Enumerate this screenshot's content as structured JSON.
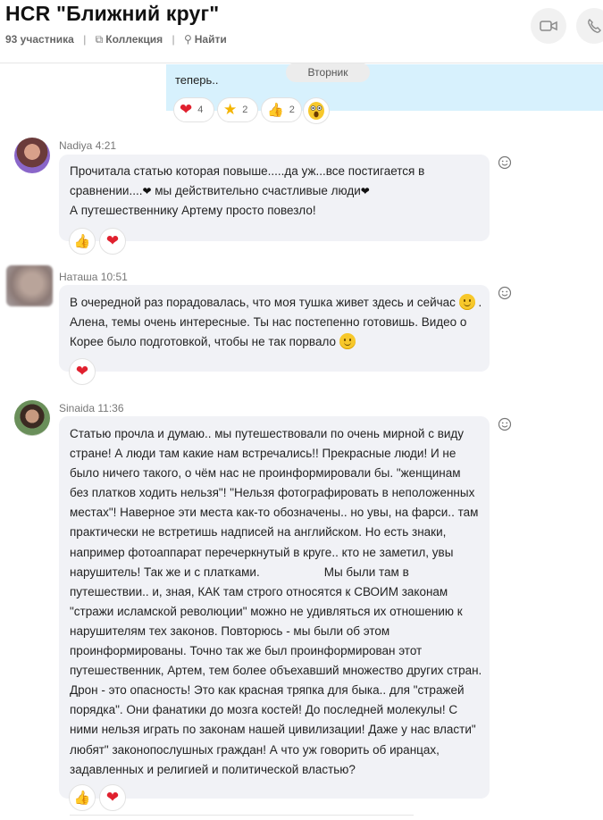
{
  "header": {
    "title": "HCR \"Ближний круг\"",
    "participants": "93 участника",
    "collection": "Коллекция",
    "find": "Найти"
  },
  "previous_message": {
    "cut_text": "...",
    "text": "теперь..",
    "day_separator": "Вторник",
    "reactions": [
      {
        "icon": "heart-icon",
        "count": "4"
      },
      {
        "icon": "star-icon",
        "count": "2"
      },
      {
        "icon": "thumbs-up-icon",
        "count": "2"
      }
    ]
  },
  "messages": [
    {
      "sender": "Nadiya",
      "time": "4:21",
      "lines": [
        "Прочитала статью которая повыше.....да уж...все постигается в",
        "сравнении....",
        " мы действительно счастливые люди",
        "А путешественнику Артему просто повезло!"
      ],
      "reactions": [
        "thumbs-up-icon",
        "heart-icon"
      ]
    },
    {
      "sender": "Наташа",
      "time": "10:51",
      "lines": [
        "В очередной раз порадовалась, что моя тушка живет здесь и сейчас",
        "Алена, темы очень интересные. Ты нас постепенно готовишь. Видео о",
        "Корее было подготовкой, чтобы не так порвало",
        "."
      ],
      "reactions": [
        "heart-icon"
      ]
    },
    {
      "sender": "Sinaida",
      "time": "11:36",
      "lines": [
        "Статью прочла и думаю.. мы путешествовали по очень мирной с виду",
        "стране! А люди там какие нам встречались!! Прекрасные люди! И не",
        "было ничего такого, о чём нас не проинформировали бы. \"женщинам",
        "без платков ходить нельзя\"! \"Нельзя фотографировать в неположенных",
        "местах\"! Наверное эти места как-то обозначены.. но увы, на фарси.. там",
        "практически не встретишь надписей на английском. Но есть знаки,",
        "например фотоаппарат перечеркнутый в круге.. кто не заметил, увы",
        "нарушитель! Так же и с платками.",
        "Мы были там в",
        "путешествии.. и, зная, КАК там строго относятся к СВОИМ законам",
        "\"стражи исламской революции\" можно не удивляться их отношению к",
        "нарушителям тех законов. Повторюсь - мы были об этом",
        "проинформированы. Точно так же был проинформирован этот",
        "путешественник, Артем, тем более объехавший множество других стран.",
        "Дрон - это опасность! Это как красная тряпка для быка.. для \"стражей",
        "порядка\". Они фанатики до мозга костей! До последней молекулы! С",
        "ними нельзя играть по законам нашей цивилизации! Даже у нас власти\"",
        "любят\" законопослушных граждан! А что уж говорить об иранцах,",
        "задавленных и религией и политической властью?"
      ],
      "reactions": [
        "thumbs-up-icon",
        "heart-icon"
      ]
    }
  ],
  "colors": {
    "own_bubble": "#d7f1fd",
    "incoming_bubble": "#f1f2f6",
    "heart": "#e0202e"
  }
}
